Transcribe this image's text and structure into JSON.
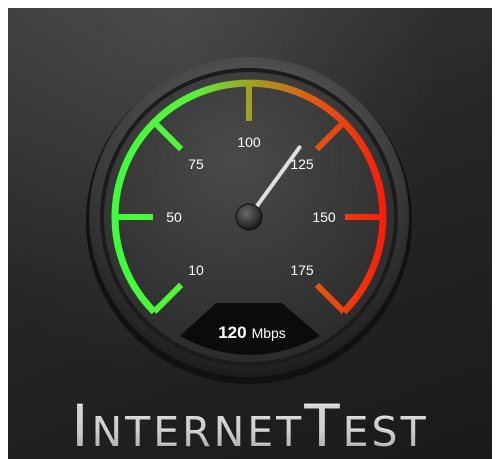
{
  "gauge": {
    "ticks": [
      {
        "label": "10",
        "value": 10
      },
      {
        "label": "50",
        "value": 50
      },
      {
        "label": "75",
        "value": 75
      },
      {
        "label": "100",
        "value": 100
      },
      {
        "label": "125",
        "value": 125
      },
      {
        "label": "150",
        "value": 150
      },
      {
        "label": "175",
        "value": 175
      }
    ],
    "needle_value": 120,
    "readout_value": "120",
    "readout_unit": "Mbps",
    "colors": {
      "low": "#3cff3c",
      "mid": "#9aa020",
      "high": "#ff1a0a",
      "needle": "#eeeeee"
    }
  },
  "title": "InternetTest"
}
